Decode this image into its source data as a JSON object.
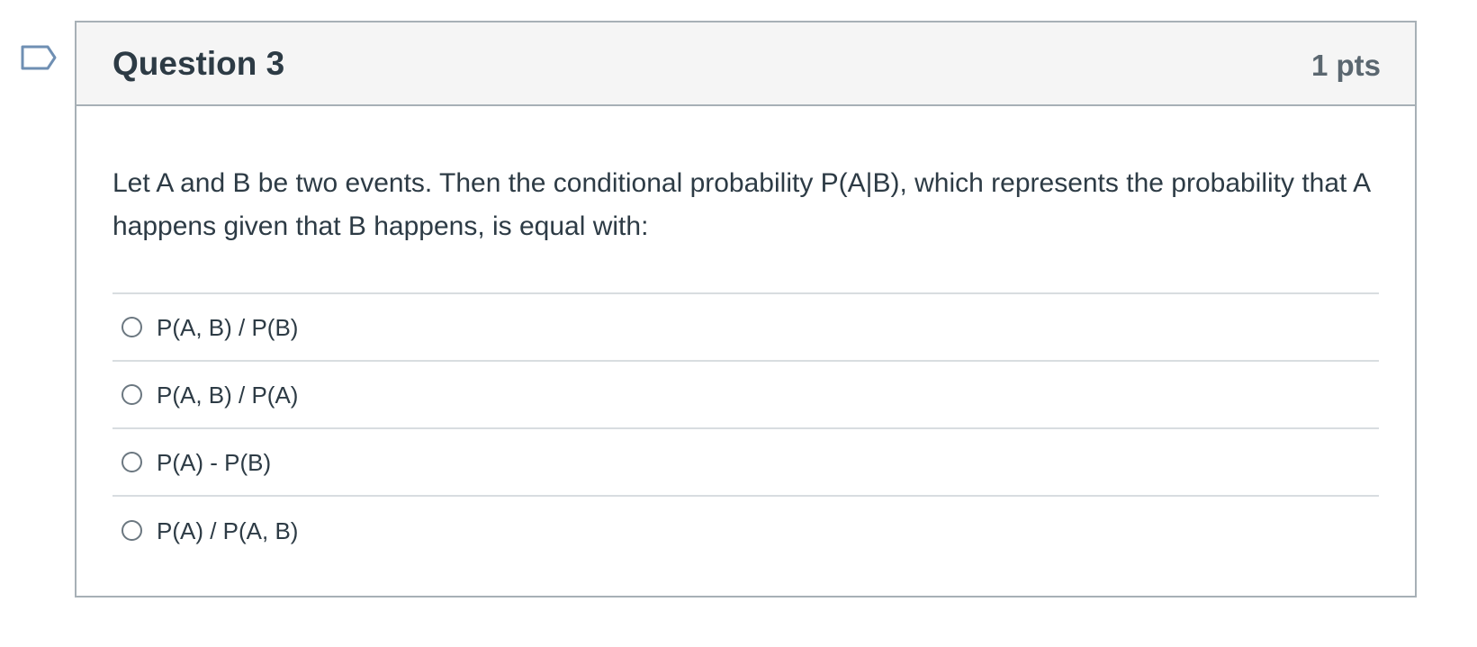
{
  "question": {
    "title": "Question 3",
    "points": "1 pts",
    "text": "Let A and B be two events. Then the conditional probability P(A|B), which represents the probability that A happens given that B happens, is equal with:",
    "flag_icon": "bookmark-flag-icon",
    "answers": [
      {
        "label": "P(A, B) / P(B)",
        "selected": false
      },
      {
        "label": "P(A, B) / P(A)",
        "selected": false
      },
      {
        "label": "P(A) - P(B)",
        "selected": false
      },
      {
        "label": "P(A) / P(A, B)",
        "selected": false
      }
    ]
  },
  "colors": {
    "border": "#a7b0b6",
    "header_bg": "#f5f5f5",
    "text": "#2d3b45",
    "flag": "#6f8fb3"
  }
}
